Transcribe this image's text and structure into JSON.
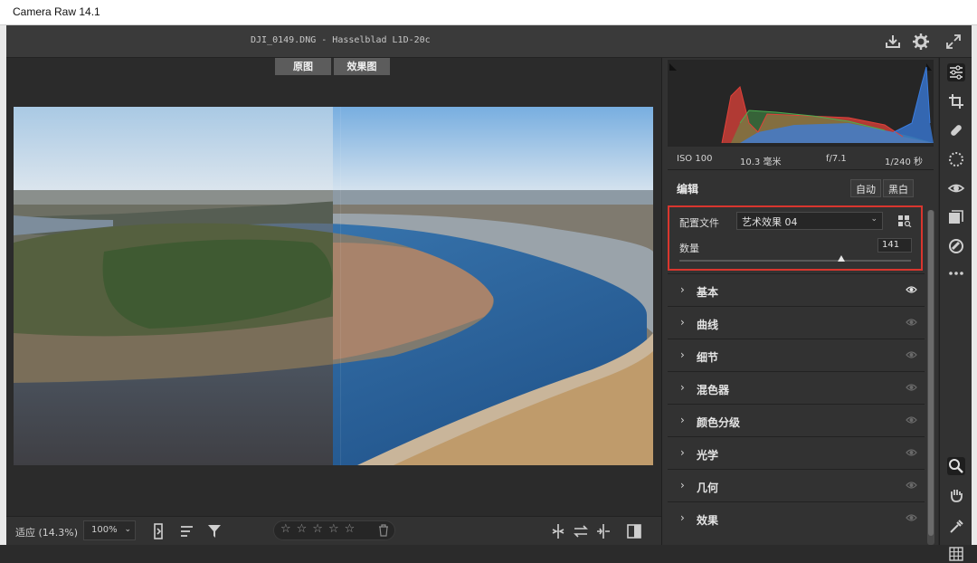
{
  "window": {
    "title": "Camera Raw 14.1"
  },
  "header": {
    "filename": "DJI_0149.DNG -  Hasselblad L1D-20c"
  },
  "view_buttons": {
    "before": "原图",
    "after": "效果图"
  },
  "exif": {
    "iso": "ISO 100",
    "focal": "10.3 毫米",
    "aperture": "f/7.1",
    "shutter": "1/240 秒"
  },
  "edit": {
    "title": "编辑",
    "auto_label": "自动",
    "bw_label": "黑白",
    "profile_label": "配置文件",
    "profile_value": "艺术效果 04",
    "amount_label": "数量",
    "amount_value": "141",
    "amount_fraction": 0.7
  },
  "sections": [
    {
      "label": "基本",
      "visible": true
    },
    {
      "label": "曲线",
      "visible": false
    },
    {
      "label": "细节",
      "visible": false
    },
    {
      "label": "混色器",
      "visible": false
    },
    {
      "label": "颜色分级",
      "visible": false
    },
    {
      "label": "光学",
      "visible": false
    },
    {
      "label": "几何",
      "visible": false
    },
    {
      "label": "效果",
      "visible": false
    }
  ],
  "bottom": {
    "zoom_fit": "适应 (14.3%)",
    "zoom_level": "100%",
    "stars": "☆☆☆☆☆"
  },
  "colors": {
    "highlight_box": "#d9362e",
    "panel_bg": "#323232",
    "histogram_red": "#e0413a",
    "histogram_green": "#4caf50",
    "histogram_blue": "#3a7de0"
  }
}
